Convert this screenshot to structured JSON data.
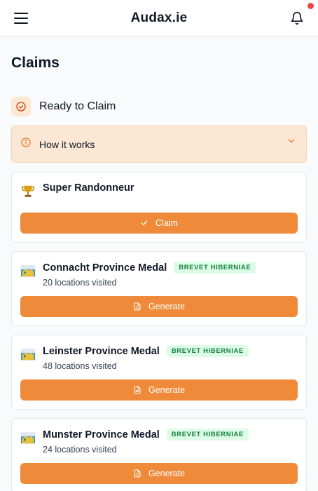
{
  "header": {
    "brand": "Audax.ie"
  },
  "page": {
    "title": "Claims"
  },
  "section": {
    "title": "Ready to Claim"
  },
  "how_it_works": {
    "label": "How it works"
  },
  "cards": [
    {
      "title": "Super Randonneur",
      "button": "Claim"
    },
    {
      "title": "Connacht Province Medal",
      "badge": "BREVET HIBERNIAE",
      "subtitle": "20 locations visited",
      "button": "Generate"
    },
    {
      "title": "Leinster Province Medal",
      "badge": "BREVET HIBERNIAE",
      "subtitle": "48 locations visited",
      "button": "Generate"
    },
    {
      "title": "Munster Province Medal",
      "badge": "BREVET HIBERNIAE",
      "subtitle": "24 locations visited",
      "button": "Generate"
    }
  ],
  "colors": {
    "accent": "#ef8a3a",
    "accent_light": "#fbe7d3",
    "badge_bg": "#dcfce7",
    "badge_text": "#15803d",
    "notification_dot": "#ef4444"
  },
  "icons": {
    "menu": "hamburger-icon",
    "notifications": "bell-icon",
    "section": "check-circle-icon",
    "info": "info-icon",
    "chevron": "chevron-down-icon",
    "trophy": "trophy-icon",
    "medal": "flag-icon",
    "check": "check-icon",
    "document": "document-icon"
  }
}
